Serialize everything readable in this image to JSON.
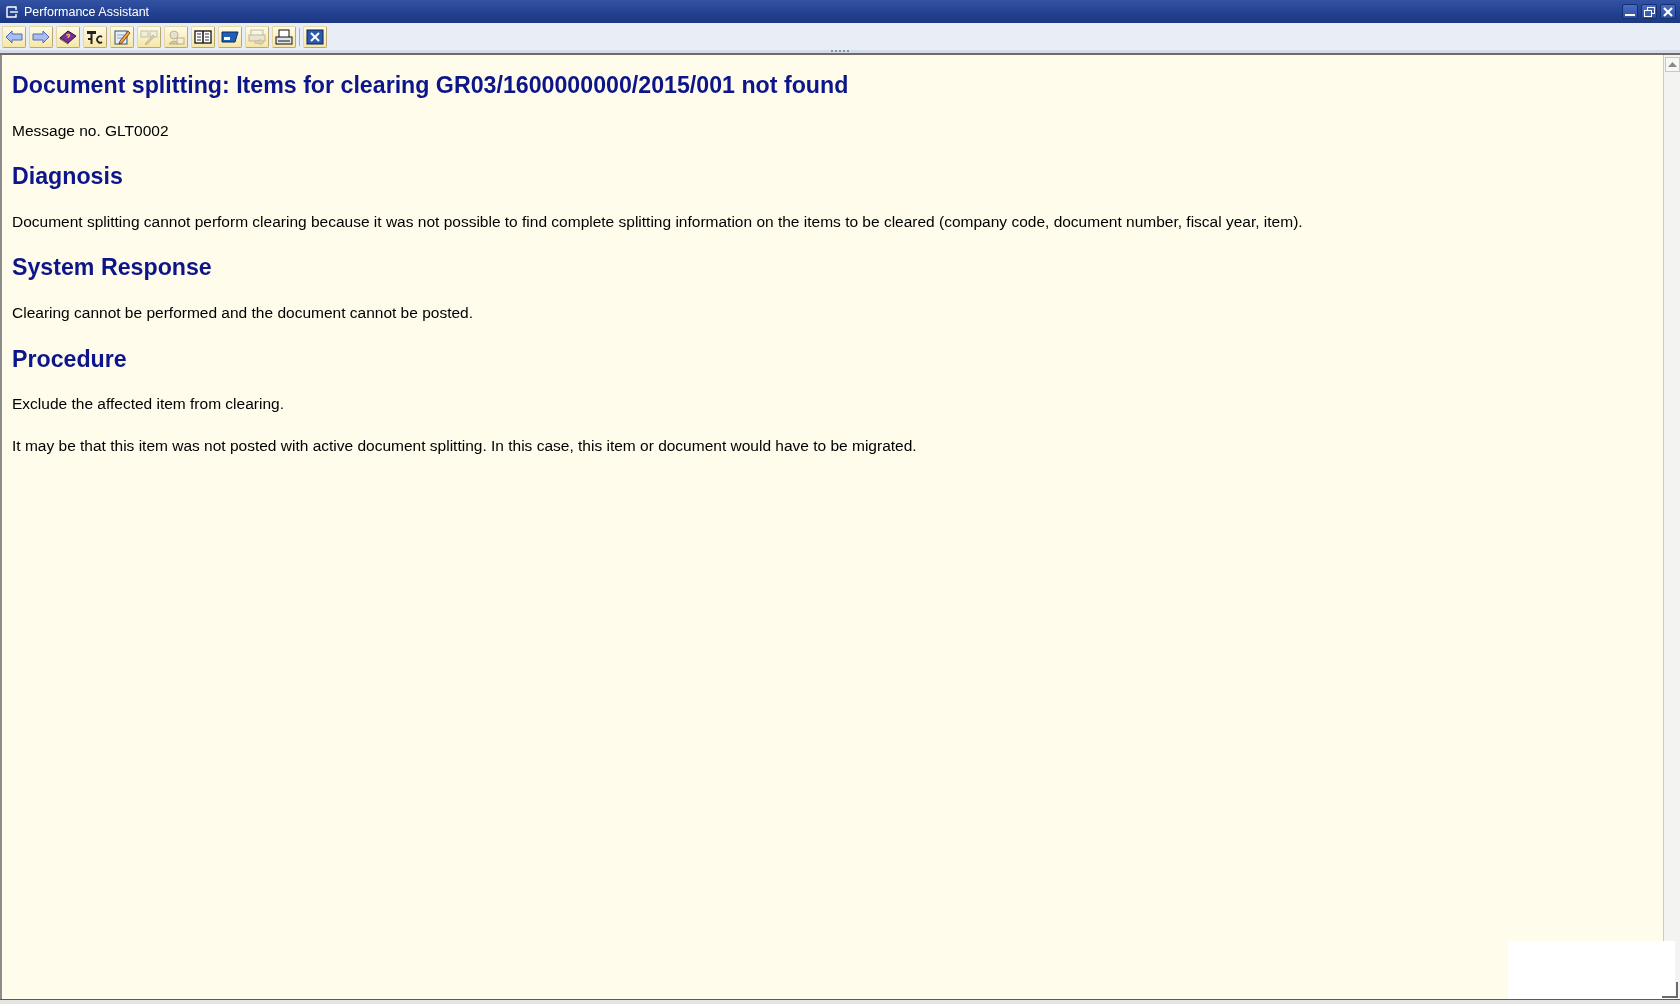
{
  "window": {
    "title": "Performance Assistant"
  },
  "toolbar": {
    "groups": [
      {
        "buttons": [
          {
            "disabled": false
          },
          {
            "disabled": false
          },
          {
            "disabled": false
          },
          {
            "disabled": false
          },
          {
            "disabled": false
          },
          {
            "disabled": true
          },
          {
            "disabled": true
          },
          {
            "disabled": false
          },
          {
            "disabled": false
          },
          {
            "disabled": true
          },
          {
            "disabled": false
          }
        ]
      },
      {
        "buttons": [
          {
            "disabled": false
          }
        ]
      }
    ]
  },
  "document": {
    "title": "Document splitting: Items for clearing GR03/1600000000/2015/001 not found",
    "message_number": "Message no. GLT0002",
    "sections": [
      {
        "heading": "Diagnosis",
        "paragraphs": [
          "Document splitting cannot perform clearing because it was not possible to find complete splitting information on the items to be cleared (company code, document number, fiscal year, item)."
        ]
      },
      {
        "heading": "System Response",
        "paragraphs": [
          "Clearing cannot be performed and the document cannot be posted."
        ]
      },
      {
        "heading": "Procedure",
        "paragraphs": [
          "Exclude the affected item from clearing.",
          "It may be that this item was not posted with active document splitting. In this case, this item or document would have to be migrated."
        ]
      }
    ]
  }
}
